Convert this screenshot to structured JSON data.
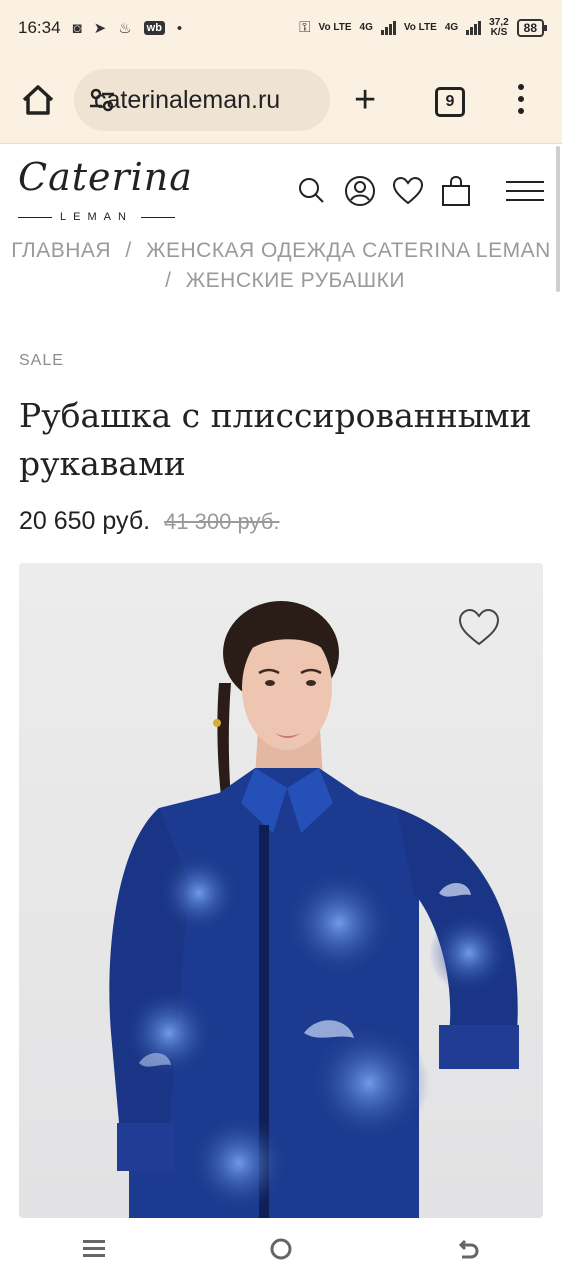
{
  "status": {
    "time": "16:34",
    "net1": "Vo LTE",
    "net2": "4G",
    "net3": "Vo LTE",
    "net4": "4G",
    "speed_value": "37,2",
    "speed_unit": "K/S",
    "battery": "88",
    "wb_label": "wb"
  },
  "browser": {
    "url": "caterinaleman.ru",
    "tab_count": "9"
  },
  "site": {
    "logo_script": "Caterina",
    "logo_sub": "LEMAN"
  },
  "breadcrumb": {
    "home": "ГЛАВНАЯ",
    "sep": "/",
    "category": "ЖЕНСКАЯ ОДЕЖДА CATERINA LEMAN",
    "subcategory": "ЖЕНСКИЕ РУБАШКИ"
  },
  "product": {
    "badge": "SALE",
    "title": "Рубашка с плиссированными рукавами",
    "price_new": "20 650 руб.",
    "price_old": "41 300 руб."
  },
  "colors": {
    "toolbar_bg": "#fbf1e3",
    "shirt_main": "#1c3a8f",
    "shirt_dark": "#122768",
    "text_muted": "#9a9a9a"
  }
}
